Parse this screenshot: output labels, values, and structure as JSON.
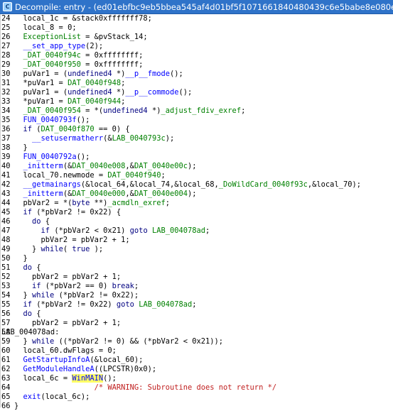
{
  "window": {
    "title": "Decompile: entry - (ed01ebfbc9eb5bbea545af4d01bf5f1071661840480439c6e5babe8e080e41"
  },
  "lines": [
    {
      "n": "24",
      "text": "  local_1c = &stack0xfffffff78;"
    },
    {
      "n": "25",
      "text": "  local_8 = 0;"
    },
    {
      "n": "26",
      "text": "  ExceptionList = &pvStack_14;"
    },
    {
      "n": "27",
      "text": "  __set_app_type(2);"
    },
    {
      "n": "28",
      "text": "  _DAT_0040f94c = 0xffffffff;"
    },
    {
      "n": "29",
      "text": "  _DAT_0040f950 = 0xffffffff;"
    },
    {
      "n": "30",
      "text": "  puVar1 = (undefined4 *)__p__fmode();"
    },
    {
      "n": "31",
      "text": "  *puVar1 = DAT_0040f948;"
    },
    {
      "n": "32",
      "text": "  puVar1 = (undefined4 *)__p__commode();"
    },
    {
      "n": "33",
      "text": "  *puVar1 = DAT_0040f944;"
    },
    {
      "n": "34",
      "text": "  _DAT_0040f954 = *(undefined4 *)_adjust_fdiv_exref;"
    },
    {
      "n": "35",
      "text": "  FUN_0040793f();"
    },
    {
      "n": "36",
      "text": "  if (DAT_0040f870 == 0) {"
    },
    {
      "n": "37",
      "text": "    __setusermatherr(&LAB_0040793c);"
    },
    {
      "n": "38",
      "text": "  }"
    },
    {
      "n": "39",
      "text": "  FUN_0040792a();"
    },
    {
      "n": "40",
      "text": "  _initterm(&DAT_0040e008,&DAT_0040e00c);"
    },
    {
      "n": "41",
      "text": "  local_70.newmode = DAT_0040f940;"
    },
    {
      "n": "42",
      "text": "  __getmainargs(&local_64,&local_74,&local_68,_DoWildCard_0040f93c,&local_70);"
    },
    {
      "n": "43",
      "text": "  _initterm(&DAT_0040e000,&DAT_0040e004);"
    },
    {
      "n": "44",
      "text": "  pbVar2 = *(byte **)_acmdln_exref;"
    },
    {
      "n": "45",
      "text": "  if (*pbVar2 != 0x22) {"
    },
    {
      "n": "46",
      "text": "    do {"
    },
    {
      "n": "47",
      "text": "      if (*pbVar2 < 0x21) goto LAB_004078ad;"
    },
    {
      "n": "48",
      "text": "      pbVar2 = pbVar2 + 1;"
    },
    {
      "n": "49",
      "text": "    } while( true );"
    },
    {
      "n": "50",
      "text": "  }"
    },
    {
      "n": "51",
      "text": "  do {"
    },
    {
      "n": "52",
      "text": "    pbVar2 = pbVar2 + 1;"
    },
    {
      "n": "53",
      "text": "    if (*pbVar2 == 0) break;"
    },
    {
      "n": "54",
      "text": "  } while (*pbVar2 != 0x22);"
    },
    {
      "n": "55",
      "text": "  if (*pbVar2 != 0x22) goto LAB_004078ad;"
    },
    {
      "n": "56",
      "text": "  do {"
    },
    {
      "n": "57",
      "text": "    pbVar2 = pbVar2 + 1;"
    },
    {
      "n": "58",
      "label": "LAB_004078ad:"
    },
    {
      "n": "59",
      "text": "  } while ((*pbVar2 != 0) && (*pbVar2 < 0x21));"
    },
    {
      "n": "60",
      "text": "  local_60.dwFlags = 0;"
    },
    {
      "n": "61",
      "text": "  GetStartupInfoA(&local_60);"
    },
    {
      "n": "62",
      "text": "  GetModuleHandleA((LPCSTR)0x0);"
    },
    {
      "n": "63",
      "pre": "  local_6c = ",
      "hl": "WinMAIN",
      "post": "();"
    },
    {
      "n": "64",
      "text": "                  /* WARNING: Subroutine does not return */"
    },
    {
      "n": "65",
      "text": "  exit(local_6c);"
    },
    {
      "n": "66",
      "text": "}"
    }
  ],
  "colors": {
    "titlebar": "#2f73c9",
    "keyword": "#000080",
    "function": "#0000ff",
    "global": "#008000",
    "comment": "#c02020",
    "highlight": "#ffff66"
  }
}
